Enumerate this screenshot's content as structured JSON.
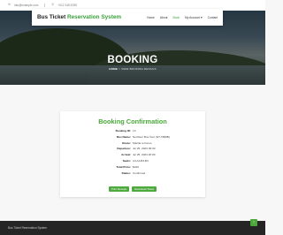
{
  "topbar": {
    "email": "info@example.com",
    "phone": "+012 345 6789",
    "email_icon": "envelope-icon",
    "phone_icon": "phone-icon"
  },
  "navbar": {
    "brand_prefix": "Bus Ticket",
    "brand_accent": "Reservation System",
    "items": [
      {
        "label": "Home",
        "active": false
      },
      {
        "label": "About",
        "active": false
      },
      {
        "label": "Book",
        "active": true
      },
      {
        "label": "My Account ▾",
        "active": false
      },
      {
        "label": "Contact",
        "active": false
      }
    ]
  },
  "hero": {
    "title": "BOOKING",
    "crumb_home": "HOME",
    "crumb_sep": ">",
    "crumb_current": "VIEW BOOKING DETAILS"
  },
  "booking": {
    "title": "Booking Confirmation",
    "fields": [
      {
        "label": "Booking ID:",
        "value": "13"
      },
      {
        "label": "Bus Name:",
        "value": "Northern Bus Tour (NT-7888B)"
      },
      {
        "label": "Route:",
        "value": "Manila to Ilocos"
      },
      {
        "label": "Departure:",
        "value": "Jul 25, 2023 09:30"
      },
      {
        "label": "Arrival:",
        "value": "Jul 25, 2023 20:00"
      },
      {
        "label": "Seats:",
        "value": "A3,A4,B3,B4"
      },
      {
        "label": "Total Price:",
        "value": "$240"
      },
      {
        "label": "Status:",
        "value": "Confirmed"
      }
    ],
    "print_button": "Print Receipt",
    "download_button": "Download Ticket"
  },
  "footer": {
    "text": "Bus Ticket Reservation System",
    "back_to_top_icon": "arrow-up-icon"
  },
  "colors": {
    "accent": "#4aa93a",
    "footer_bg": "#252525"
  }
}
